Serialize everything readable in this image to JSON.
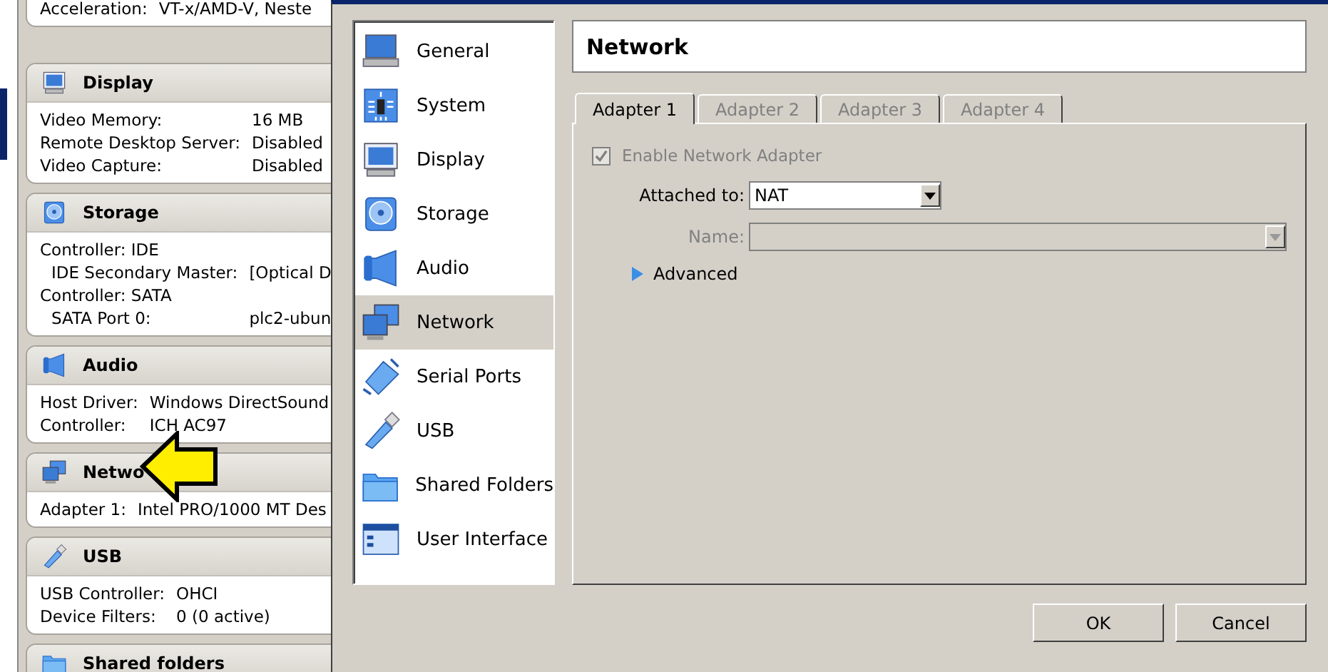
{
  "vm_details": {
    "sections": [
      {
        "rows": [
          {
            "label": "Acceleration:",
            "value": "VT-x/AMD-V, Neste"
          }
        ]
      },
      {
        "kind": "display",
        "title": "Display",
        "rows": [
          {
            "label": "Video Memory:",
            "value": "16 MB"
          },
          {
            "label": "Remote Desktop Server:",
            "value": "Disabled"
          },
          {
            "label": "Video Capture:",
            "value": "Disabled"
          }
        ]
      },
      {
        "kind": "storage",
        "title": "Storage",
        "rows": [
          {
            "label": "Controller: IDE",
            "children": [
              {
                "label": "IDE Secondary Master:",
                "value": "[Optical D"
              }
            ]
          },
          {
            "label": "Controller: SATA",
            "children": [
              {
                "label": "SATA Port 0:",
                "value": "plc2-ubun"
              }
            ]
          }
        ]
      },
      {
        "kind": "audio",
        "title": "Audio",
        "rows": [
          {
            "label": "Host Driver:",
            "value": "Windows DirectSound"
          },
          {
            "label": "Controller:",
            "value": "ICH AC97"
          }
        ]
      },
      {
        "kind": "network",
        "title": "Netwo",
        "rows": [
          {
            "label": "Adapter 1:",
            "value": "Intel PRO/1000 MT Des"
          }
        ]
      },
      {
        "kind": "usb",
        "title": "USB",
        "rows": [
          {
            "label": "USB Controller:",
            "value": "OHCI"
          },
          {
            "label": "Device Filters:",
            "value": "0 (0 active)"
          }
        ]
      },
      {
        "kind": "folder",
        "title": "Shared folders"
      }
    ]
  },
  "settings_dialog": {
    "categories": [
      {
        "kind": "general",
        "label": "General",
        "selected": false
      },
      {
        "kind": "system",
        "label": "System",
        "selected": false
      },
      {
        "kind": "display",
        "label": "Display",
        "selected": false
      },
      {
        "kind": "storage",
        "label": "Storage",
        "selected": false
      },
      {
        "kind": "audio",
        "label": "Audio",
        "selected": false
      },
      {
        "kind": "network",
        "label": "Network",
        "selected": true
      },
      {
        "kind": "serial",
        "label": "Serial Ports",
        "selected": false
      },
      {
        "kind": "usb",
        "label": "USB",
        "selected": false
      },
      {
        "kind": "folder",
        "label": "Shared Folders",
        "selected": false
      },
      {
        "kind": "ui",
        "label": "User Interface",
        "selected": false
      }
    ],
    "page_title": "Network",
    "tabs": [
      {
        "label": "Adapter 1",
        "selected": true
      },
      {
        "label": "Adapter 2",
        "selected": false
      },
      {
        "label": "Adapter 3",
        "selected": false
      },
      {
        "label": "Adapter 4",
        "selected": false
      }
    ],
    "enable_adapter": {
      "label": "Enable Network Adapter",
      "checked": true,
      "disabled": true
    },
    "attached_to": {
      "label": "Attached to:",
      "value": "NAT",
      "disabled": false
    },
    "name": {
      "label": "Name:",
      "disabled": true
    },
    "advanced": {
      "label": "Advanced",
      "expanded": false
    },
    "buttons": [
      "OK",
      "Cancel"
    ]
  }
}
